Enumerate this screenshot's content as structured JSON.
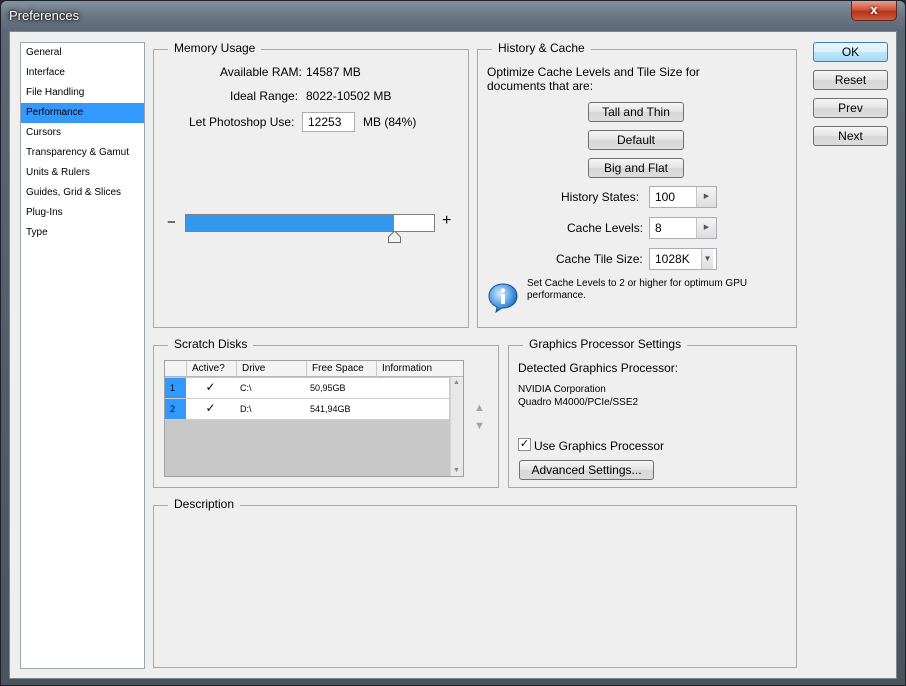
{
  "window": {
    "title": "Preferences",
    "close_glyph": "x"
  },
  "nav": {
    "items": [
      {
        "label": "General"
      },
      {
        "label": "Interface"
      },
      {
        "label": "File Handling"
      },
      {
        "label": "Performance"
      },
      {
        "label": "Cursors"
      },
      {
        "label": "Transparency & Gamut"
      },
      {
        "label": "Units & Rulers"
      },
      {
        "label": "Guides, Grid & Slices"
      },
      {
        "label": "Plug-Ins"
      },
      {
        "label": "Type"
      }
    ],
    "selected": "Performance"
  },
  "memory": {
    "title": "Memory Usage",
    "available_label": "Available RAM:",
    "available_value": "14587 MB",
    "ideal_label": "Ideal Range:",
    "ideal_value": "8022-10502 MB",
    "let_label": "Let Photoshop Use:",
    "let_value": "12253",
    "let_suffix": "MB (84%)",
    "minus": "−",
    "plus": "+",
    "slider_fraction": 0.84
  },
  "history": {
    "title": "History & Cache",
    "description": "Optimize Cache Levels and Tile Size for documents that are:",
    "btn_tall": "Tall and Thin",
    "btn_default": "Default",
    "btn_big": "Big and Flat",
    "states_label": "History States:",
    "states_value": "100",
    "levels_label": "Cache Levels:",
    "levels_value": "8",
    "tile_label": "Cache Tile Size:",
    "tile_value": "1028K",
    "info_text": "Set Cache Levels to 2 or higher for optimum GPU performance."
  },
  "scratch": {
    "title": "Scratch Disks",
    "columns": [
      "Active?",
      "Drive",
      "Free Space",
      "Information"
    ],
    "rows": [
      {
        "num": "1",
        "drive": "C:\\",
        "free": "50,95GB",
        "info": ""
      },
      {
        "num": "2",
        "drive": "D:\\",
        "free": "541,94GB",
        "info": ""
      }
    ]
  },
  "gpu": {
    "title": "Graphics Processor Settings",
    "detected_label": "Detected Graphics Processor:",
    "vendor": "NVIDIA Corporation",
    "model": "Quadro M4000/PCIe/SSE2",
    "use_label": "Use Graphics Processor",
    "advanced": "Advanced Settings..."
  },
  "description": {
    "title": "Description"
  },
  "buttons": {
    "ok": "OK",
    "reset": "Reset",
    "prev": "Prev",
    "next": "Next"
  },
  "colors": {
    "accent": "#3399ff",
    "slider_fill": "#3399ee",
    "dialog_bg": "#efefef"
  }
}
